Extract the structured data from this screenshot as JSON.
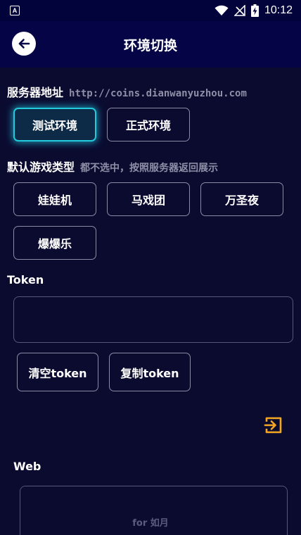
{
  "status_bar": {
    "time": "10:12",
    "app_badge": "A",
    "icons": [
      "wifi-icon",
      "no-signal-icon",
      "battery-charging-icon"
    ]
  },
  "header": {
    "title": "环境切换",
    "back_icon": "arrow-left-icon"
  },
  "server": {
    "label": "服务器地址",
    "url": "http://coins.dianwanyuzhou.com",
    "options": [
      {
        "label": "测试环境",
        "selected": true
      },
      {
        "label": "正式环境",
        "selected": false
      }
    ]
  },
  "game_type": {
    "label": "默认游戏类型",
    "hint": "都不选中，按照服务器返回展示",
    "options": [
      {
        "label": "娃娃机"
      },
      {
        "label": "马戏团"
      },
      {
        "label": "万圣夜"
      },
      {
        "label": "爆爆乐"
      }
    ]
  },
  "token": {
    "label": "Token",
    "value": "",
    "clear_label": "清空token",
    "copy_label": "复制token"
  },
  "web": {
    "label": "Web",
    "value": ""
  },
  "footer": {
    "text": "for 如月"
  },
  "colors": {
    "background": "#0b0b30",
    "appbar": "#040446",
    "accent_selected": "#23c9dd",
    "export_icon": "#f5a623",
    "hint": "#8e8fa6"
  }
}
